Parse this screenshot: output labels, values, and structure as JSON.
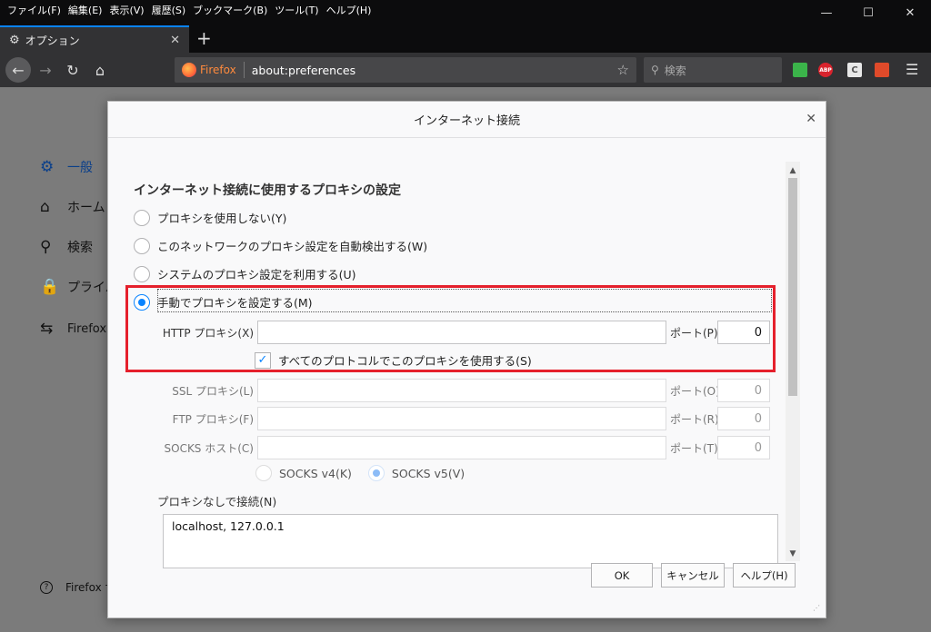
{
  "menubar": {
    "items": [
      "ファイル(F)",
      "編集(E)",
      "表示(V)",
      "履歴(S)",
      "ブックマーク(B)",
      "ツール(T)",
      "ヘルプ(H)"
    ]
  },
  "tab": {
    "title": "オプション"
  },
  "urlbar": {
    "identity": "Firefox",
    "url": "about:preferences"
  },
  "searchbar": {
    "placeholder": "検索"
  },
  "sidebar": {
    "items": [
      {
        "label": "一般",
        "icon": "gear-icon"
      },
      {
        "label": "ホーム",
        "icon": "home-icon"
      },
      {
        "label": "検索",
        "icon": "search-icon"
      },
      {
        "label": "プライバ",
        "icon": "lock-icon"
      },
      {
        "label": "Firefox",
        "icon": "sync-icon"
      }
    ],
    "footer": "Firefox サ"
  },
  "dialog": {
    "title": "インターネット接続",
    "section_title": "インターネット接続に使用するプロキシの設定",
    "options": {
      "no_proxy": "プロキシを使用しない(Y)",
      "auto_detect": "このネットワークのプロキシ設定を自動検出する(W)",
      "system": "システムのプロキシ設定を利用する(U)",
      "manual": "手動でプロキシを設定する(M)"
    },
    "selected_option": "manual",
    "http": {
      "label": "HTTP プロキシ(X)",
      "value": "",
      "port_label": "ポート(P)",
      "port": "0"
    },
    "use_for_all": {
      "label": "すべてのプロトコルでこのプロキシを使用する(S)",
      "checked": true
    },
    "ssl": {
      "label": "SSL プロキシ(L)",
      "value": "",
      "port_label": "ポート(O)",
      "port": "0"
    },
    "ftp": {
      "label": "FTP プロキシ(F)",
      "value": "",
      "port_label": "ポート(R)",
      "port": "0"
    },
    "socks": {
      "label": "SOCKS ホスト(C)",
      "value": "",
      "port_label": "ポート(T)",
      "port": "0"
    },
    "socks_v4": "SOCKS v4(K)",
    "socks_v5": "SOCKS v5(V)",
    "socks_selected": "v5",
    "no_proxy_label": "プロキシなしで接続(N)",
    "no_proxy_value": "localhost, 127.0.0.1",
    "buttons": {
      "ok": "OK",
      "cancel": "キャンセル",
      "help": "ヘルプ(H)"
    }
  },
  "colors": {
    "accent": "#0a84ff",
    "highlight": "#e5202c",
    "chrome": "#0c0c0d"
  }
}
